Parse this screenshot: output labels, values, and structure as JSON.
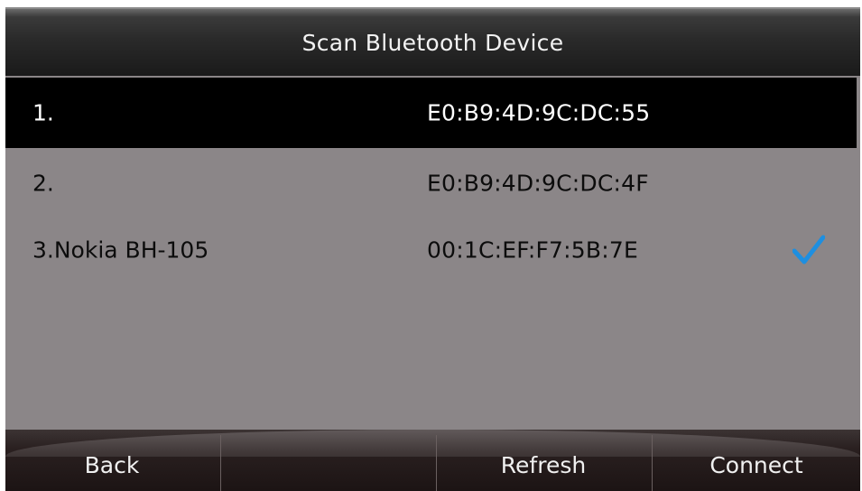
{
  "header": {
    "title": "Scan Bluetooth Device"
  },
  "devices": [
    {
      "name": "1.",
      "address": "E0:B9:4D:9C:DC:55",
      "selected": true,
      "connected": false
    },
    {
      "name": "2.",
      "address": "E0:B9:4D:9C:DC:4F",
      "selected": false,
      "connected": false
    },
    {
      "name": "3.Nokia BH-105",
      "address": "00:1C:EF:F7:5B:7E",
      "selected": false,
      "connected": true
    }
  ],
  "softkeys": {
    "key1": "Back",
    "key2": "",
    "key3": "Refresh",
    "key4": "Connect"
  },
  "icons": {
    "connected": "checkmark-icon"
  },
  "colors": {
    "selected_bg": "#000000",
    "list_bg": "#8b8688",
    "checkmark": "#1e8fe0"
  }
}
